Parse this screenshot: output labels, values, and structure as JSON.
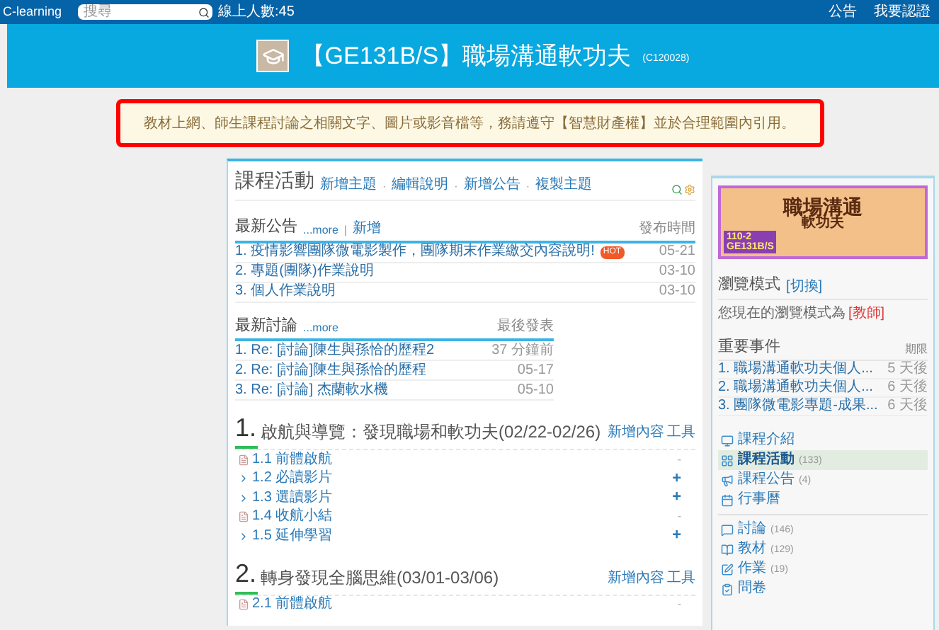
{
  "topbar": {
    "brand": "C-learning",
    "search": {
      "placeholder": "搜尋"
    },
    "online": "線上人數:45",
    "links": [
      "公告",
      "我要認證"
    ]
  },
  "header": {
    "title": "【GE131B/S】職場溝通軟功夫",
    "code": "(C120028)"
  },
  "notice": {
    "text": "教材上網、師生課程討論之相關文字、圖片或影音檔等，務請遵守【智慧財產權】並於合理範圍內引用。",
    "highlighted": true
  },
  "activity": {
    "title": "課程活動",
    "links": [
      "新增主題",
      "編輯說明",
      "新增公告",
      "複製主題"
    ],
    "link_separator": "·",
    "announcements": {
      "title": "最新公告",
      "more": "...more",
      "separator": "|",
      "add": "新增",
      "date_header": "發布時間",
      "rows": [
        {
          "text": "1. 疫情影響團隊微電影製作，團隊期末作業繳交內容說明!",
          "badge": "HOT",
          "date": "05-21"
        },
        {
          "text": "2. 專題(團隊)作業說明",
          "date": "03-10"
        },
        {
          "text": "3. 個人作業說明",
          "date": "03-10"
        }
      ]
    },
    "discussions": {
      "title": "最新討論",
      "more": "...more",
      "date_header": "最後發表",
      "rows": [
        {
          "text": "1. Re: [討論]陳生與孫恰的歷程2",
          "date": "37 分鐘前"
        },
        {
          "text": "2. Re: [討論]陳生與孫恰的歷程",
          "date": "05-17"
        },
        {
          "text": "3. Re: [討論] 杰蘭軟水機",
          "date": "05-10"
        }
      ]
    },
    "sections": [
      {
        "number": "1.",
        "title": "啟航與導覽：發現職場和軟功夫(02/22-02/26)",
        "tools": [
          "新增內容",
          "工具"
        ],
        "items": [
          {
            "kind": "file",
            "label": "1.1 前體啟航",
            "action": "-"
          },
          {
            "kind": "folder",
            "label": "1.2 必讀影片",
            "action": "+"
          },
          {
            "kind": "folder",
            "label": "1.3 選讀影片",
            "action": "+"
          },
          {
            "kind": "file",
            "label": "1.4 收航小結",
            "action": "-"
          },
          {
            "kind": "folder",
            "label": "1.5 延伸學習",
            "action": "+"
          }
        ]
      },
      {
        "number": "2.",
        "title": "轉身發現全腦思維(03/01-03/06)",
        "tools": [
          "新增內容",
          "工具"
        ],
        "items": [
          {
            "kind": "file",
            "label": "2.1 前體啟航",
            "action": "-"
          }
        ]
      }
    ]
  },
  "sidebar": {
    "banner": {
      "title": "職場溝通",
      "subtitle": "軟功夫",
      "term": "110-2",
      "code": "GE131B/S"
    },
    "browse_mode": {
      "title": "瀏覽模式",
      "switch": "[切換]",
      "text": "您現在的瀏覽模式為",
      "mode": "[教師]"
    },
    "events": {
      "title": "重要事件",
      "header": "期限",
      "rows": [
        {
          "text": "1. 職場溝通軟功夫個人...",
          "due": "5 天後"
        },
        {
          "text": "2. 職場溝通軟功夫個人...",
          "due": "6 天後"
        },
        {
          "text": "3. 團隊微電影專題-成果...",
          "due": "6 天後"
        }
      ]
    },
    "menu": [
      {
        "kind": "intro",
        "label": "課程介紹",
        "selected": false
      },
      {
        "kind": "activity",
        "label": "課程活動",
        "count": "(133)",
        "selected": true
      },
      {
        "kind": "announce",
        "label": "課程公告",
        "count": "(4)",
        "selected": false
      },
      {
        "kind": "calendar",
        "label": "行事曆",
        "selected": false
      },
      {
        "kind": "divider"
      },
      {
        "kind": "forum",
        "label": "討論",
        "count": "(146)",
        "selected": false
      },
      {
        "kind": "material",
        "label": "教材",
        "count": "(129)",
        "selected": false
      },
      {
        "kind": "homework",
        "label": "作業",
        "count": "(19)",
        "selected": false
      },
      {
        "kind": "survey",
        "label": "問卷",
        "selected": false
      }
    ]
  }
}
